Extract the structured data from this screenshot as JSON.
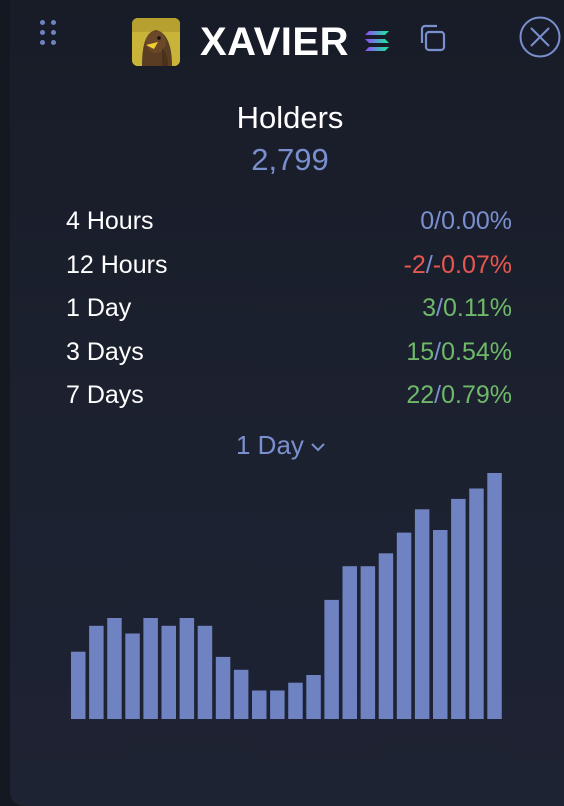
{
  "header": {
    "token_name": "XAVIER",
    "icons": {
      "menu": "grip-dots-icon",
      "chain": "solana-icon",
      "copy": "copy-icon",
      "close": "close-circle-icon"
    }
  },
  "holders": {
    "title": "Holders",
    "count": "2,799"
  },
  "stats": [
    {
      "label": "4 Hours",
      "change": "0",
      "percent": "0.00%",
      "tone": "neutral"
    },
    {
      "label": "12 Hours",
      "change": "-2",
      "percent": "-0.07%",
      "tone": "negative"
    },
    {
      "label": "1 Day",
      "change": "3",
      "percent": "0.11%",
      "tone": "positive"
    },
    {
      "label": "3 Days",
      "change": "15",
      "percent": "0.54%",
      "tone": "positive"
    },
    {
      "label": "7 Days",
      "change": "22",
      "percent": "0.79%",
      "tone": "positive"
    }
  ],
  "period_selector": {
    "selected": "1 Day",
    "icon": "chevron-down-icon"
  },
  "colors": {
    "accent": "#7a8fce",
    "bar": "#6f82c2",
    "positive": "#6fb86a",
    "negative": "#e8574f"
  },
  "chart_data": {
    "type": "bar",
    "series": [
      {
        "values": [
          16,
          26,
          29,
          23,
          29,
          26,
          29,
          26,
          14,
          9,
          1,
          1,
          4,
          7,
          36,
          49,
          49,
          54,
          62,
          71,
          63,
          75,
          79,
          85
        ]
      }
    ],
    "ylim": [
      -10,
      85
    ],
    "grid": false,
    "legend": "none"
  }
}
